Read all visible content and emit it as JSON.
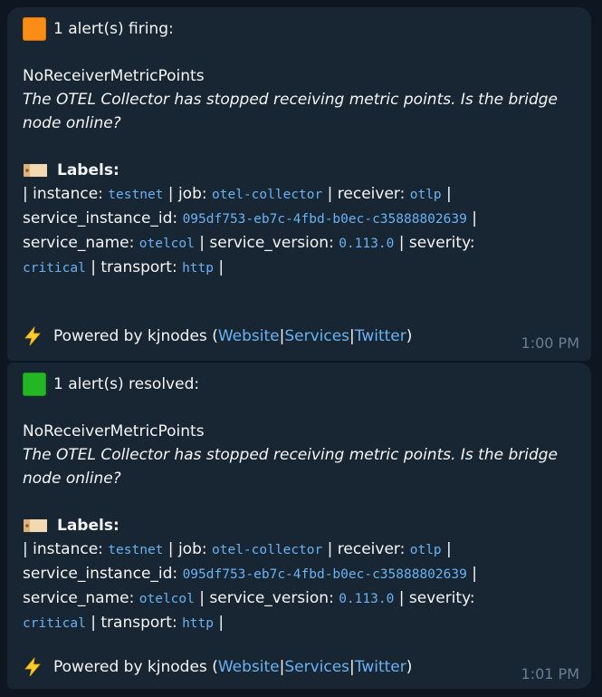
{
  "messages": [
    {
      "header": "1 alert(s) firing:",
      "status_color": "#f98d16",
      "alert_name": "NoReceiverMetricPoints",
      "description": "The OTEL Collector has stopped receiving metric points. Is the bridge node online?",
      "labels_title": "Labels:",
      "labels": {
        "instance_key": "instance:",
        "instance_val": "testnet",
        "job_key": "job:",
        "job_val": "otel-collector",
        "receiver_key": "receiver:",
        "receiver_val": "otlp",
        "service_instance_id_key": "service_instance_id:",
        "service_instance_id_val": "095df753-eb7c-4fbd-b0ec-c35888802639",
        "service_name_key": "service_name:",
        "service_name_val": "otelcol",
        "service_version_key": "service_version:",
        "service_version_val": "0.113.0",
        "severity_key": "severity:",
        "severity_val": "critical",
        "transport_key": "transport:",
        "transport_val": "http"
      },
      "footer": {
        "powered_by": "Powered by kjnodes (",
        "website": "Website",
        "services": "Services",
        "twitter": "Twitter",
        "close": ")"
      },
      "time": "1:00 PM"
    },
    {
      "header": "1 alert(s) resolved:",
      "status_color": "#24b624",
      "alert_name": "NoReceiverMetricPoints",
      "description": "The OTEL Collector has stopped receiving metric points. Is the bridge node online?",
      "labels_title": "Labels:",
      "labels": {
        "instance_key": "instance:",
        "instance_val": "testnet",
        "job_key": "job:",
        "job_val": "otel-collector",
        "receiver_key": "receiver:",
        "receiver_val": "otlp",
        "service_instance_id_key": "service_instance_id:",
        "service_instance_id_val": "095df753-eb7c-4fbd-b0ec-c35888802639",
        "service_name_key": "service_name:",
        "service_name_val": "otelcol",
        "service_version_key": "service_version:",
        "service_version_val": "0.113.0",
        "severity_key": "severity:",
        "severity_val": "critical",
        "transport_key": "transport:",
        "transport_val": "http"
      },
      "footer": {
        "powered_by": "Powered by kjnodes (",
        "website": "Website",
        "services": "Services",
        "twitter": "Twitter",
        "close": ")"
      },
      "time": "1:01 PM"
    }
  ],
  "icons": {
    "firing": "orange-square-icon",
    "resolved": "green-square-icon",
    "labels": "label-tag-icon",
    "powered": "lightning-bolt-icon"
  },
  "colors": {
    "background": "#0e1621",
    "bubble": "#182533",
    "link": "#6ab2f2",
    "timestamp": "#6b7f93"
  }
}
